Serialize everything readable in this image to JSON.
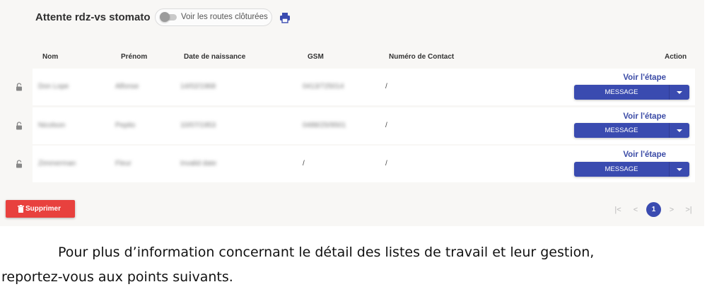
{
  "header": {
    "title": "Attente rdz-vs stomato",
    "toggle_label": "Voir les routes clôturées",
    "print_icon": "printer-icon"
  },
  "table": {
    "columns": [
      "Nom",
      "Prénom",
      "Date de naissance",
      "GSM",
      "Numéro de Contact",
      "Action"
    ],
    "rows": [
      {
        "nom": "Don Lope",
        "prenom": "Alfonse",
        "naissance": "14/02/1968",
        "gsm": "0413/725014",
        "contact": "/",
        "voir": "Voir l'étape",
        "message": "MESSAGE"
      },
      {
        "nom": "Nicolson",
        "prenom": "Pepito",
        "naissance": "10/07/1953",
        "gsm": "0488/25/9501",
        "contact": "/",
        "voir": "Voir l'étape",
        "message": "MESSAGE"
      },
      {
        "nom": "Zimmerman",
        "prenom": "Fleur",
        "naissance": "Invalid date",
        "gsm": "/",
        "contact": "/",
        "voir": "Voir l'étape",
        "message": "MESSAGE"
      }
    ],
    "row_icon": "unlock-icon"
  },
  "actions": {
    "delete_label": "Supprimer",
    "delete_icon": "trash-icon"
  },
  "pagination": {
    "first": "|<",
    "prev": "<",
    "current": "1",
    "next": ">",
    "last": ">|"
  },
  "paragraph": {
    "line1": "Pour plus d’information concernant le détail des listes de travail et leur gestion,",
    "line2": "reportez-vous aux points suivants."
  },
  "colors": {
    "accent": "#3a4bb0",
    "danger": "#e8413e",
    "panel_bg": "#f8f7f5"
  }
}
